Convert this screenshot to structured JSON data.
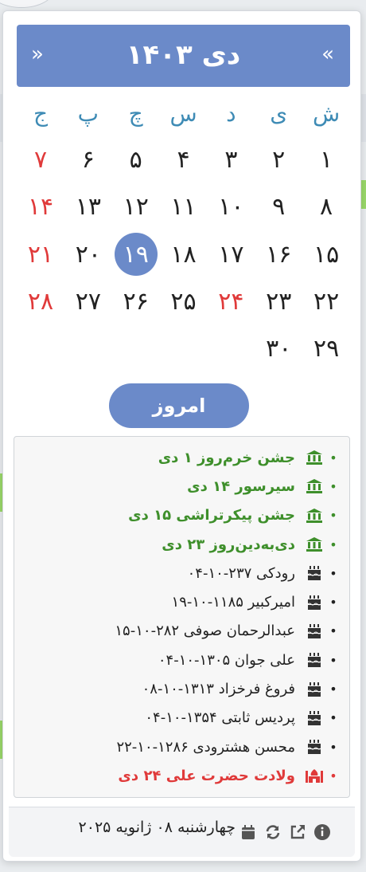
{
  "header": {
    "title": "دی ۱۴۰۳",
    "prev": "«",
    "next": "»"
  },
  "weekdays": [
    "ش",
    "ی",
    "د",
    "س",
    "چ",
    "پ",
    "ج"
  ],
  "weeks": [
    [
      "۱",
      "۲",
      "۳",
      "۴",
      "۵",
      "۶",
      "۷"
    ],
    [
      "۸",
      "۹",
      "۱۰",
      "۱۱",
      "۱۲",
      "۱۳",
      "۱۴"
    ],
    [
      "۱۵",
      "۱۶",
      "۱۷",
      "۱۸",
      "۱۹",
      "۲۰",
      "۲۱"
    ],
    [
      "۲۲",
      "۲۳",
      "۲۴",
      "۲۵",
      "۲۶",
      "۲۷",
      "۲۸"
    ],
    [
      "۲۹",
      "۳۰"
    ]
  ],
  "today_button": "امروز",
  "events": [
    {
      "icon": "monument-icon",
      "text": "جشن خرم‌روز ۱ دی"
    },
    {
      "icon": "monument-icon",
      "text": "سیرسور ۱۴ دی"
    },
    {
      "icon": "monument-icon",
      "text": "جشن پیکرتراشی ۱۵ دی"
    },
    {
      "icon": "monument-icon",
      "text": "دی‌به‌دین‌روز ۲۳ دی"
    },
    {
      "icon": "birthday-cake-icon",
      "text": "رودکی ۲۳۷-۱۰-۰۴"
    },
    {
      "icon": "birthday-cake-icon",
      "text": "امیرکبیر ۱۱۸۵-۱۰-۱۹"
    },
    {
      "icon": "birthday-cake-icon",
      "text": "عبدالرحمان صوفی ۲۸۲-۱۰-۱۵"
    },
    {
      "icon": "birthday-cake-icon",
      "text": "علی جوان ۱۳۰۵-۱۰-۰۴"
    },
    {
      "icon": "birthday-cake-icon",
      "text": "فروغ فرخزاد ۱۳۱۳-۱۰-۰۸"
    },
    {
      "icon": "birthday-cake-icon",
      "text": "پردیس ثابتی ۱۳۵۴-۱۰-۰۴"
    },
    {
      "icon": "birthday-cake-icon",
      "text": "محسن هشترودی ۱۲۸۶-۱۰-۲۲"
    },
    {
      "icon": "mosque-icon",
      "text": "ولادت حضرت علی ۲۴ دی"
    }
  ],
  "footer": {
    "date": "چهارشنبه ۰۸ ژانویه ۲۰۲۵"
  },
  "colors": {
    "accent": "#6b8ac9",
    "holiday": "#e03a3a",
    "weekday_header": "#3e8bb5",
    "event_green": "#3e8f2b"
  }
}
